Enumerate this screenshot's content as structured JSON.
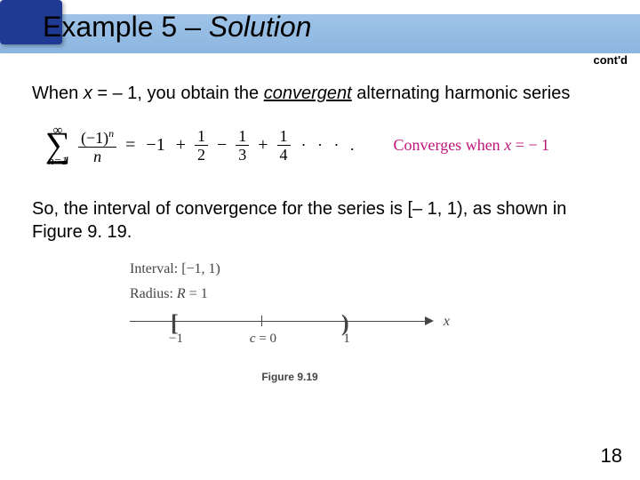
{
  "title": {
    "prefix": "Example 5 – ",
    "solution": "Solution"
  },
  "contd": "cont'd",
  "para1": {
    "pre": "When ",
    "var": "x",
    "mid": " = – 1, you obtain the ",
    "conv": "convergent",
    "post": " alternating harmonic series"
  },
  "formula": {
    "sigma_top": "∞",
    "sigma_bot": "n=1",
    "main_num": "(−1)",
    "main_exp": "n",
    "main_den": "n",
    "eq": " = ",
    "t1": "−1",
    "plus": " + ",
    "minus": " − ",
    "f2n": "1",
    "f2d": "2",
    "f3n": "1",
    "f3d": "3",
    "f4n": "1",
    "f4d": "4",
    "dots": "· · · .",
    "note_pre": "Converges when ",
    "note_var": "x",
    "note_post": " = − 1"
  },
  "para2": "So, the interval of convergence for the series is [– 1, 1), as shown in Figure 9. 19.",
  "figure": {
    "line1": "Interval: [−1, 1)",
    "line2_pre": "Radius: ",
    "line2_var": "R",
    "line2_post": " = 1",
    "lab_neg1": "−1",
    "lab_c_var": "c",
    "lab_c_post": " = 0",
    "lab_1": "1",
    "xlabel": "x",
    "caption": "Figure 9.19"
  },
  "page": "18"
}
